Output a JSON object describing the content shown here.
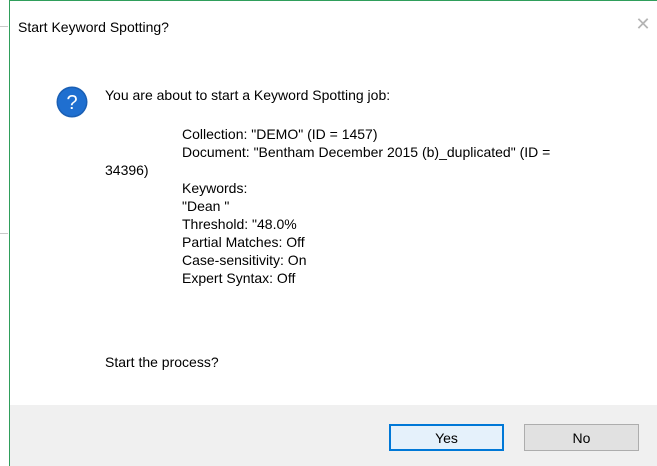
{
  "dialog": {
    "title": "Start Keyword Spotting?",
    "close_glyph": "✕",
    "icon": "question-icon",
    "heading": "You are about to start a Keyword Spotting job:",
    "details": {
      "collection": "Collection: \"DEMO\" (ID = 1457)",
      "document_line1": "Document: \"Bentham December 2015 (b)_duplicated\" (ID =",
      "document_line2": "34396)",
      "keywords_label": "Keywords:",
      "keyword_value": "\"Dean \"",
      "threshold": "Threshold: \"48.0%",
      "partial_matches": "Partial Matches: Off",
      "case_sensitivity": "Case-sensitivity: On",
      "expert_syntax": "Expert Syntax: Off"
    },
    "question": "Start the process?",
    "buttons": {
      "yes": "Yes",
      "no": "No"
    }
  },
  "colors": {
    "accent": "#0078d7",
    "window_border": "#2f9e5b",
    "footer_bg": "#f0f0f0"
  }
}
